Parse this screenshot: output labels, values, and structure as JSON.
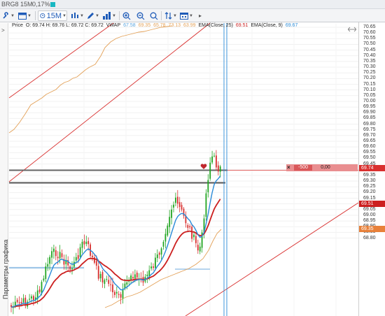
{
  "title": {
    "symbol": "BRG8 15M",
    "change": "0,17%"
  },
  "toolbar": {
    "timeframe": "15M"
  },
  "side_panel": {
    "label": "Параметры графика"
  },
  "legend": {
    "price_label": "Price",
    "ohlc": "O: 69.74 H: 69.76 L: 69.72 C: 69.72",
    "vwap_label": "VWAP",
    "vwap_values": [
      "67.58",
      "69.35",
      "65.78",
      "73.13",
      "63.99"
    ],
    "ema25_label": "EMA(Close, 25)",
    "ema25_value": "69.51",
    "ema9_label": "EMA(Close, 9)",
    "ema9_value": "69.67"
  },
  "order": {
    "qty": "-500",
    "value": "0,00"
  },
  "axis": {
    "ticks": [
      "70.65",
      "70.60",
      "70.55",
      "70.50",
      "70.45",
      "70.40",
      "70.35",
      "70.30",
      "70.25",
      "70.20",
      "70.15",
      "70.10",
      "70.05",
      "70.00",
      "69.95",
      "69.90",
      "69.85",
      "69.80",
      "69.75",
      "69.70",
      "69.65",
      "69.60",
      "69.55",
      "69.50",
      "69.45",
      "69.40",
      "69.35",
      "69.30",
      "69.25",
      "69.20",
      "69.15",
      "69.10",
      "69.05",
      "69.00",
      "68.95",
      "68.90",
      "68.85",
      "68.80"
    ],
    "price_tag": "69.74",
    "ema25_tag": "69.51",
    "vwap_tag": "69.35"
  },
  "colors": {
    "bull": "#21a521",
    "bear": "#d9302f",
    "ema9": "#2a8bd8",
    "ema25": "#cc1f1f",
    "vwap": "#e3a158",
    "channel": "#d9302f",
    "accent": "#19b7c2"
  }
}
